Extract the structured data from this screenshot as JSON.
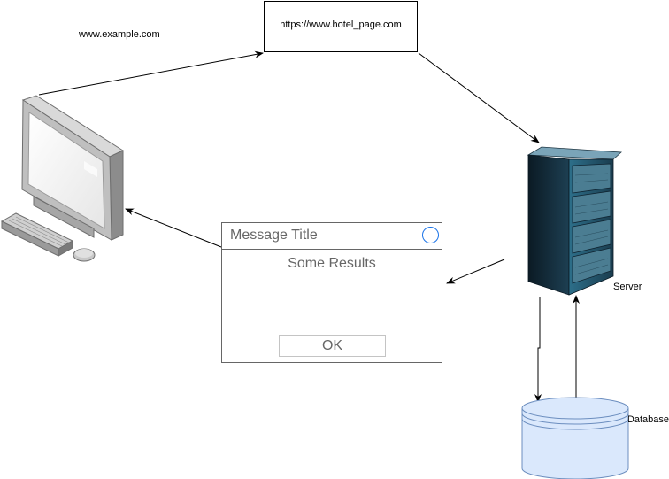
{
  "labels": {
    "client_url": "www.example.com",
    "url_box": "https://www.hotel_page.com",
    "server": "Server",
    "database": "Database"
  },
  "message_window": {
    "title": "Message Title",
    "body": "Some Results",
    "ok_label": "OK"
  },
  "icons": {
    "computer": "desktop-computer-icon",
    "server": "server-rack-icon",
    "database": "database-cylinder-icon",
    "close": "circle-close-icon"
  },
  "colors": {
    "database_fill": "#dae8fc",
    "database_stroke": "#6c8ebf",
    "close_button": "#1a73e8",
    "window_border": "#666666"
  }
}
